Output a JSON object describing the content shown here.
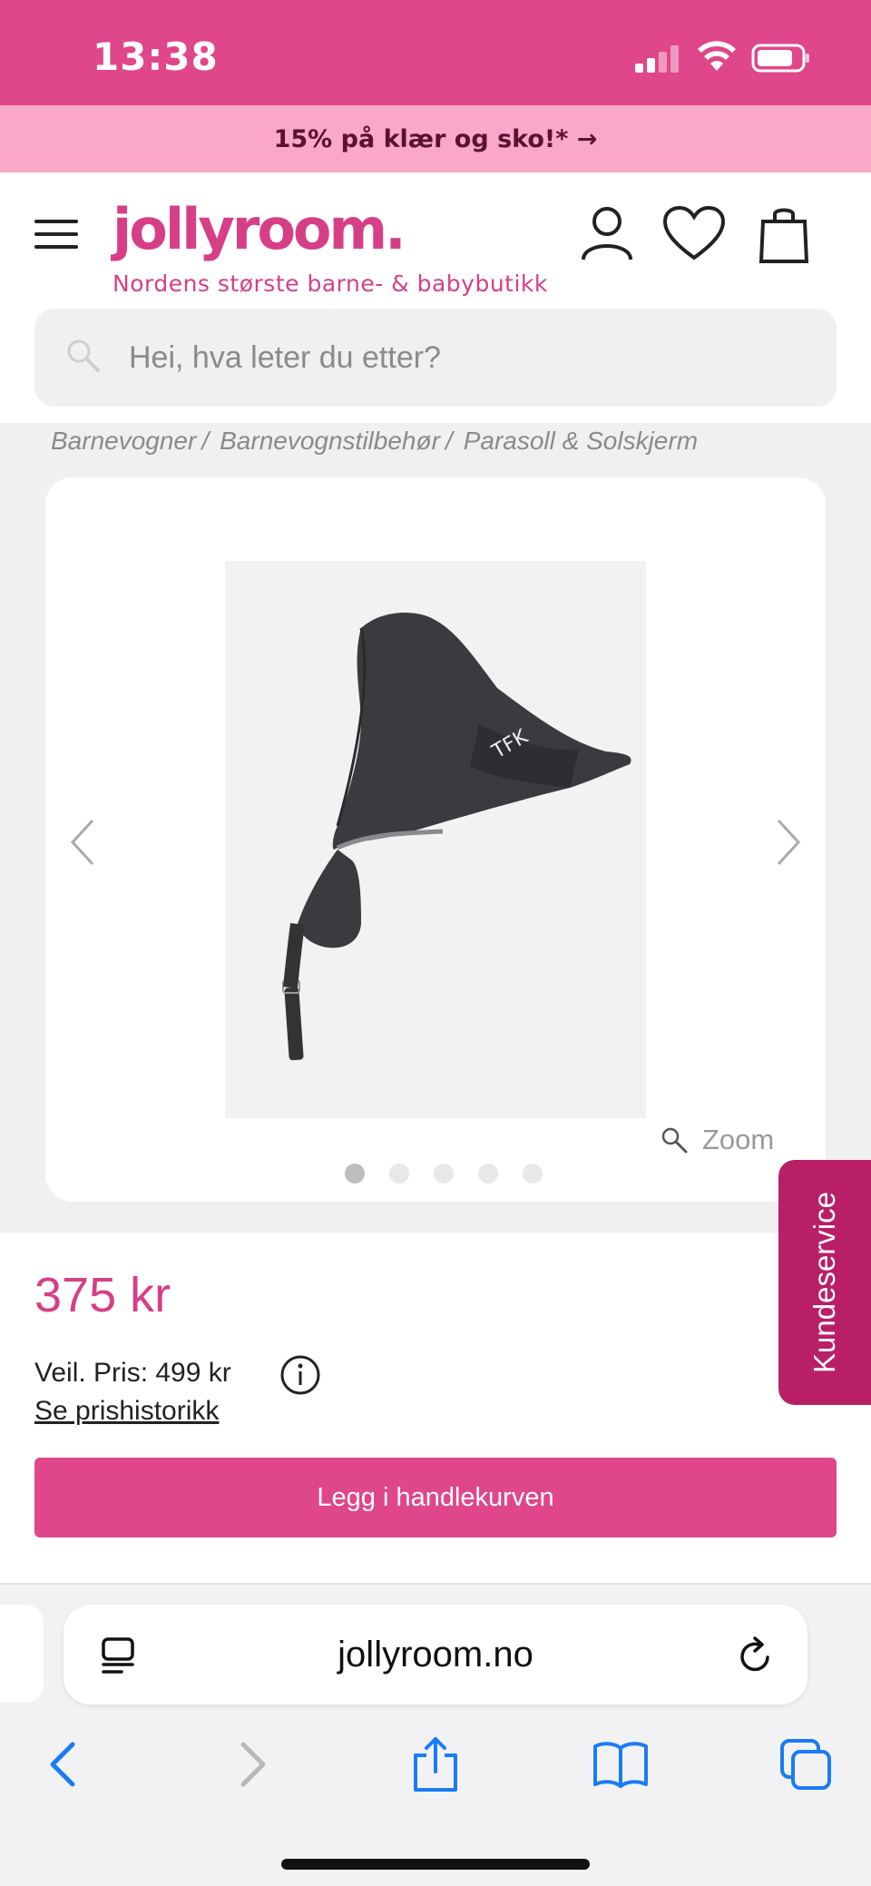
{
  "status_bar": {
    "time": "13:38"
  },
  "promo": {
    "text": "15% på klær og sko!* →"
  },
  "header": {
    "logo": "jollyroom.",
    "tagline": "Nordens største barne- & babybutikk"
  },
  "search": {
    "placeholder": "Hei, hva leter du etter?"
  },
  "breadcrumb": [
    {
      "label": "Barnevogner",
      "sep": "/"
    },
    {
      "label": "Barnevognstilbehør",
      "sep": "/"
    },
    {
      "label": "Parasoll & Solskjerm",
      "sep": ""
    }
  ],
  "gallery": {
    "zoom_label": "Zoom",
    "image_count": 5,
    "active_index": 0
  },
  "kundeservice": {
    "label": "Kundeservice"
  },
  "product": {
    "price": "375 kr",
    "recommended_price": "Veil. Pris: 499 kr",
    "history_link": "Se prishistorikk",
    "add_to_cart": "Legg i handlekurven"
  },
  "browser": {
    "url": "jollyroom.no"
  },
  "colors": {
    "brand_pink": "#e0468a",
    "promo_bg": "#f9a8c7",
    "kundeservice_bg": "#b81f66",
    "ios_blue": "#1a7cf5"
  }
}
